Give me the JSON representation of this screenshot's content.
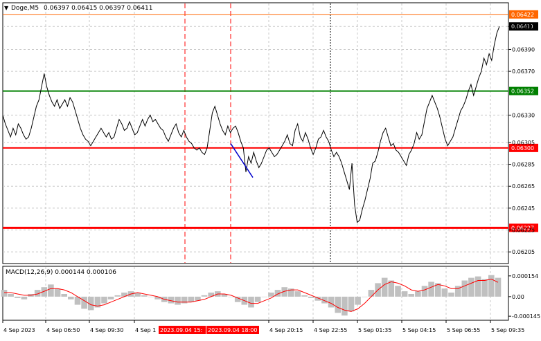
{
  "header": {
    "symbol": "Doge,M5",
    "ohlc": "0.06397 0.06415 0.06397 0.06411"
  },
  "colors": {
    "price_line": "#000000",
    "grid": "#c8c8c8",
    "level_red": "#ff0000",
    "level_green": "#008000",
    "level_orange": "#ff6600",
    "current_price_bg": "#000000",
    "macd_hist": "#c0c0c0",
    "macd_signal": "#ff0000",
    "trend_line": "#0000cc",
    "session_marker": "#ff0000"
  },
  "chart_data": [
    {
      "type": "line",
      "title": "Doge,M5",
      "ylim": [
        0.06195,
        0.06432
      ],
      "y_ticks": [
        "0.06411",
        "0.06390",
        "0.06370",
        "0.06330",
        "0.06305",
        "0.06285",
        "0.06265",
        "0.06245",
        "0.06225",
        "0.06205"
      ],
      "x_ticks": [
        "4 Sep 2023",
        "4 Sep 06:50",
        "4 Sep 09:30",
        "4 Sep 1",
        "4 Sep 20:15",
        "4 Sep 22:55",
        "5 Sep 01:35",
        "5 Sep 04:15",
        "5 Sep 06:55",
        "5 Sep 09:35"
      ],
      "highlight_times": [
        "2023.09.04 15:",
        "2023.09.04 18:00"
      ],
      "grid": true,
      "current_price": {
        "label": "0.06411",
        "value": 0.06411
      },
      "levels": [
        {
          "label": "0.06422",
          "value": 0.06422,
          "color": "orange"
        },
        {
          "label": "0.06352",
          "value": 0.06352,
          "color": "green"
        },
        {
          "label": "0.06300",
          "value": 0.063,
          "color": "red"
        },
        {
          "label": "0.06227",
          "value": 0.06227,
          "color": "red"
        }
      ],
      "series": [
        {
          "values": [
            0.0633,
            0.06322,
            0.06316,
            0.0631,
            0.06318,
            0.06312,
            0.06322,
            0.06318,
            0.06312,
            0.06308,
            0.0631,
            0.06318,
            0.06328,
            0.06338,
            0.06344,
            0.06356,
            0.06368,
            0.06356,
            0.06348,
            0.06342,
            0.06338,
            0.06344,
            0.06336,
            0.0634,
            0.06344,
            0.06338,
            0.06346,
            0.06342,
            0.06334,
            0.06326,
            0.06318,
            0.06312,
            0.06308,
            0.06306,
            0.06302,
            0.06306,
            0.0631,
            0.06314,
            0.06318,
            0.06314,
            0.0631,
            0.06314,
            0.06308,
            0.0631,
            0.06318,
            0.06326,
            0.06322,
            0.06316,
            0.06318,
            0.06324,
            0.06318,
            0.06312,
            0.06314,
            0.0632,
            0.06326,
            0.0632,
            0.06326,
            0.0633,
            0.06324,
            0.06326,
            0.06322,
            0.06318,
            0.06316,
            0.0631,
            0.06306,
            0.06312,
            0.06318,
            0.06322,
            0.06314,
            0.0631,
            0.06316,
            0.0631,
            0.06306,
            0.06304,
            0.063,
            0.06298,
            0.063,
            0.06296,
            0.06294,
            0.063,
            0.06316,
            0.06332,
            0.06338,
            0.0633,
            0.06322,
            0.06316,
            0.06312,
            0.0632,
            0.06314,
            0.06318,
            0.0632,
            0.06314,
            0.06306,
            0.063,
            0.06278,
            0.06292,
            0.06286,
            0.06296,
            0.06288,
            0.06282,
            0.06286,
            0.06292,
            0.06298,
            0.063,
            0.06296,
            0.06292,
            0.06294,
            0.06298,
            0.06302,
            0.06306,
            0.06312,
            0.06304,
            0.06302,
            0.06316,
            0.06322,
            0.0631,
            0.06306,
            0.06314,
            0.06308,
            0.063,
            0.06294,
            0.063,
            0.06308,
            0.0631,
            0.06316,
            0.0631,
            0.06306,
            0.06298,
            0.06292,
            0.06296,
            0.06292,
            0.06286,
            0.06278,
            0.0627,
            0.06262,
            0.06286,
            0.06248,
            0.06232,
            0.06234,
            0.06244,
            0.06252,
            0.06262,
            0.06272,
            0.06286,
            0.06288,
            0.06296,
            0.06306,
            0.06314,
            0.06318,
            0.0631,
            0.06302,
            0.06304,
            0.06298,
            0.06296,
            0.06292,
            0.06288,
            0.06284,
            0.06294,
            0.06298,
            0.06304,
            0.06314,
            0.06308,
            0.06312,
            0.06324,
            0.06336,
            0.06342,
            0.06348,
            0.06342,
            0.06336,
            0.06328,
            0.06318,
            0.06308,
            0.06302,
            0.06306,
            0.0631,
            0.06318,
            0.06326,
            0.06334,
            0.06338,
            0.06344,
            0.06352,
            0.06358,
            0.06348,
            0.06356,
            0.06364,
            0.0637,
            0.06382,
            0.06376,
            0.06386,
            0.0638,
            0.06394,
            0.06405,
            0.06411
          ]
        }
      ]
    },
    {
      "type": "bar",
      "title": "MACD(12,26,9) 0.000144 0.000106",
      "ylim": [
        -0.00017,
        0.00022
      ],
      "y_ticks": [
        "0.000154",
        "0.00",
        "-0.000145"
      ],
      "series": [
        {
          "name": "MACD",
          "values": [
            5e-05,
            2e-05,
            -1e-05,
            -2e-05,
            2e-05,
            5e-05,
            7e-05,
            9e-05,
            6e-05,
            2e-05,
            -2e-05,
            -6e-05,
            -9e-05,
            -0.0001,
            -8e-05,
            -5e-05,
            -2e-05,
            1e-05,
            3e-05,
            4e-05,
            3e-05,
            1e-05,
            0.0,
            -2e-05,
            -4e-05,
            -5e-05,
            -6e-05,
            -5e-05,
            -4e-05,
            -3e-05,
            1e-05,
            3e-05,
            4e-05,
            2e-05,
            0.0,
            -4e-05,
            -6e-05,
            -8e-05,
            -4e-05,
            0.0,
            3e-05,
            5e-05,
            7e-05,
            6e-05,
            4e-05,
            1e-05,
            -1e-05,
            -3e-05,
            -5e-05,
            -8e-05,
            -0.00012,
            -0.00014,
            -0.00011,
            -6e-05,
            0.0,
            5e-05,
            0.0001,
            0.00014,
            0.00012,
            8e-05,
            4e-05,
            2e-05,
            4e-05,
            8e-05,
            0.00011,
            0.0001,
            6e-05,
            3e-05,
            8e-05,
            0.00012,
            0.00014,
            0.00015,
            0.00013,
            0.00016,
            0.00014
          ]
        },
        {
          "name": "Signal",
          "values": [
            3e-05,
            3e-05,
            2e-05,
            1e-05,
            1e-05,
            2e-05,
            4e-05,
            6e-05,
            6e-05,
            5e-05,
            3e-05,
            0.0,
            -3e-05,
            -6e-05,
            -7e-05,
            -6e-05,
            -4e-05,
            -2e-05,
            0.0,
            2e-05,
            3e-05,
            2e-05,
            1e-05,
            0.0,
            -2e-05,
            -3e-05,
            -4e-05,
            -4e-05,
            -4e-05,
            -3e-05,
            -2e-05,
            0.0,
            2e-05,
            2e-05,
            1e-05,
            -1e-05,
            -3e-05,
            -5e-05,
            -5e-05,
            -3e-05,
            -1e-05,
            2e-05,
            4e-05,
            5e-05,
            5e-05,
            3e-05,
            1e-05,
            -1e-05,
            -3e-05,
            -5e-05,
            -8e-05,
            -0.0001,
            -0.00011,
            -9e-05,
            -5e-05,
            0.0,
            5e-05,
            9e-05,
            0.00011,
            0.0001,
            8e-05,
            5e-05,
            4e-05,
            5e-05,
            7e-05,
            9e-05,
            8e-05,
            6e-05,
            6e-05,
            8e-05,
            0.0001,
            0.00012,
            0.00012,
            0.00013,
            0.000106
          ]
        }
      ]
    }
  ]
}
